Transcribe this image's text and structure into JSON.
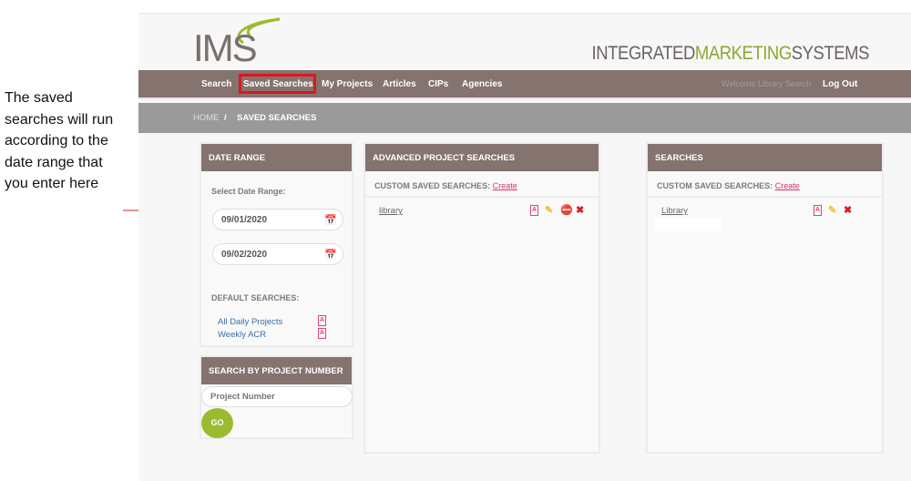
{
  "annotation": "The saved searches will run according to the date range that you enter here",
  "header": {
    "logo_text": "IMS",
    "tagline": [
      "INTEGRATED",
      "MARKETING",
      "SYSTEMS"
    ]
  },
  "nav": {
    "items": [
      "Search",
      "Saved Searches",
      "My Projects",
      "Articles",
      "CIPs",
      "Agencies"
    ],
    "welcome": "Welcome Library Search",
    "logout": "Log Out"
  },
  "breadcrumb": {
    "home": "HOME",
    "sep": "/",
    "current": "SAVED SEARCHES"
  },
  "date_range": {
    "title": "DATE RANGE",
    "label": "Select Date Range:",
    "start": "09/01/2020",
    "end": "09/02/2020",
    "default_label": "DEFAULT SEARCHES:",
    "defaults": [
      "All Daily Projects",
      "Weekly ACR"
    ]
  },
  "project_search": {
    "title": "SEARCH BY PROJECT NUMBER",
    "placeholder": "Project Number",
    "go": "GO"
  },
  "advanced": {
    "title": "ADVANCED PROJECT SEARCHES",
    "custom_label": "CUSTOM SAVED SEARCHES:",
    "create": "Create",
    "items": [
      "library"
    ]
  },
  "searches": {
    "title": "SEARCHES",
    "custom_label": "CUSTOM SAVED SEARCHES:",
    "create": "Create",
    "items": [
      "Library"
    ]
  },
  "colors": {
    "nav": "#857370",
    "accent_green": "#9bbb2f",
    "link_pink": "#d2336f",
    "highlight": "#e0161c"
  }
}
